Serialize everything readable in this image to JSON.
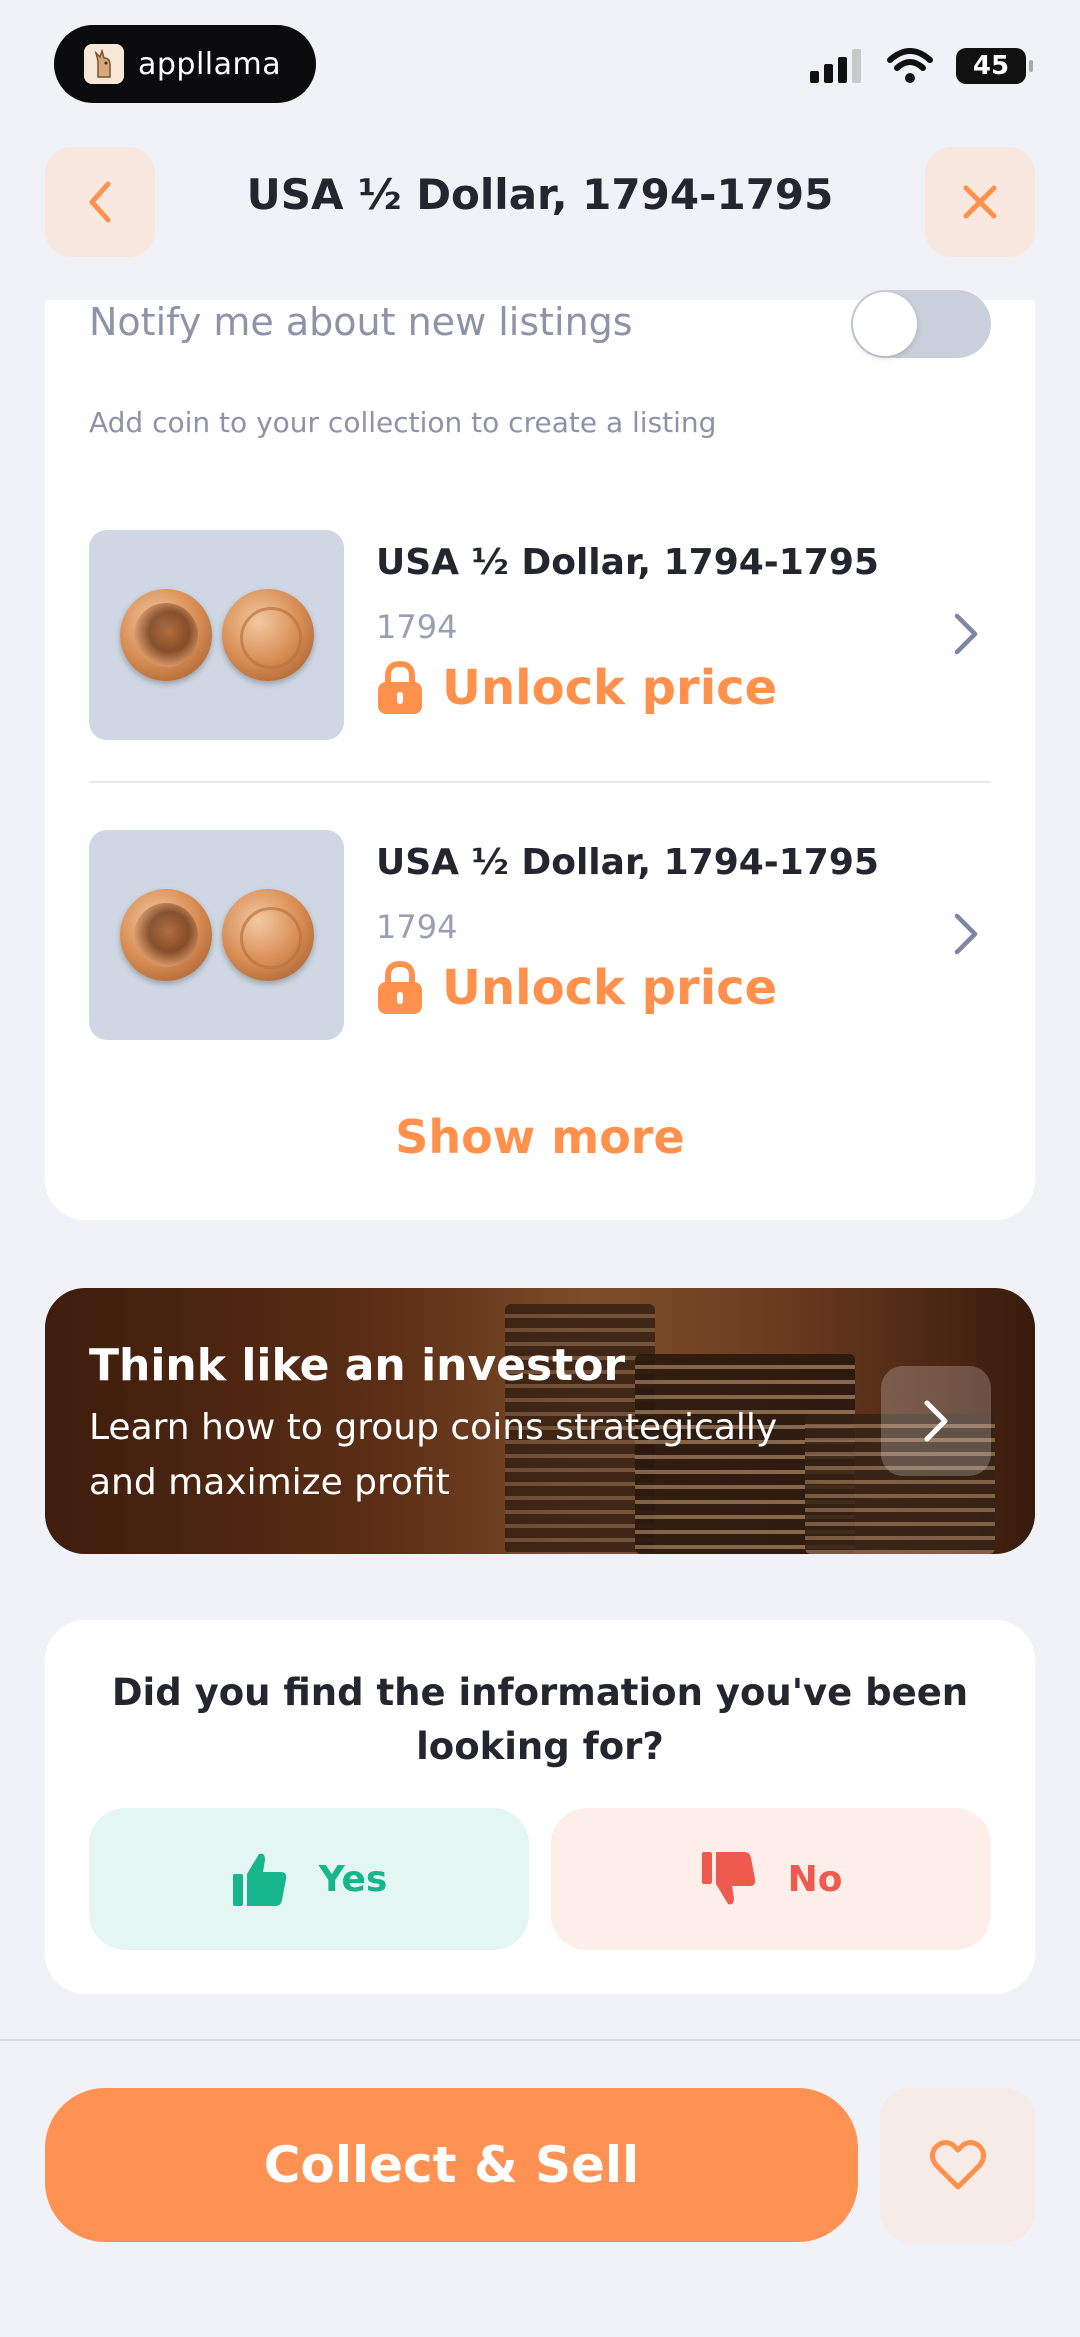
{
  "status_bar": {
    "app_badge": "appllama",
    "battery": "45"
  },
  "header": {
    "title": "USA ½ Dollar, 1794-1795"
  },
  "notifications": {
    "label": "Notify me about new listings",
    "enabled": false
  },
  "listings": {
    "hint": "Add coin to your collection to create a listing",
    "items": [
      {
        "title": "USA ½ Dollar, 1794-1795",
        "year": "1794",
        "price_label": "Unlock price"
      },
      {
        "title": "USA ½ Dollar, 1794-1795",
        "year": "1794",
        "price_label": "Unlock price"
      }
    ],
    "show_more": "Show more"
  },
  "banner": {
    "title": "Think like an investor",
    "subtitle": "Learn how to group coins strategically and maximize profit"
  },
  "feedback": {
    "question": "Did you find the information you've been looking for?",
    "yes_label": "Yes",
    "no_label": "No"
  },
  "footer": {
    "cta_label": "Collect & Sell"
  },
  "colors": {
    "accent": "#ff914d",
    "yes": "#17b58b",
    "no": "#ee5a4d",
    "background": "#f1f2f7"
  }
}
